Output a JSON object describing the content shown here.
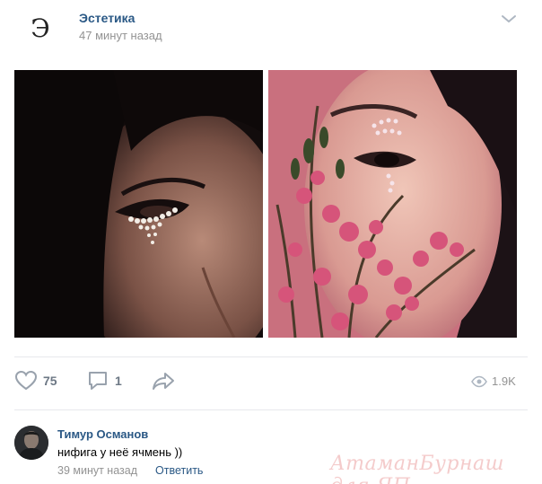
{
  "post": {
    "avatar_letter": "Э",
    "group_name": "Эстетика",
    "time": "47 минут назад",
    "photos": [
      {
        "name": "photo-woman-pearl-eyeliner"
      },
      {
        "name": "photo-woman-pink-flowers"
      }
    ]
  },
  "actions": {
    "likes": "75",
    "comments": "1",
    "views": "1.9K",
    "icons": [
      "heart-icon",
      "comment-icon",
      "share-icon",
      "eye-icon",
      "chevron-down-icon"
    ]
  },
  "comment": {
    "author": "Тимур Османов",
    "text": "нифига у неё ячмень ))",
    "time": "39 минут назад",
    "reply_label": "Ответить"
  },
  "watermark": "АтаманБурнаш для ЯП",
  "colors": {
    "link": "#2a5885",
    "secondary_text": "#939393",
    "icon": "#99a2ad",
    "divider": "#e7e8ec"
  }
}
